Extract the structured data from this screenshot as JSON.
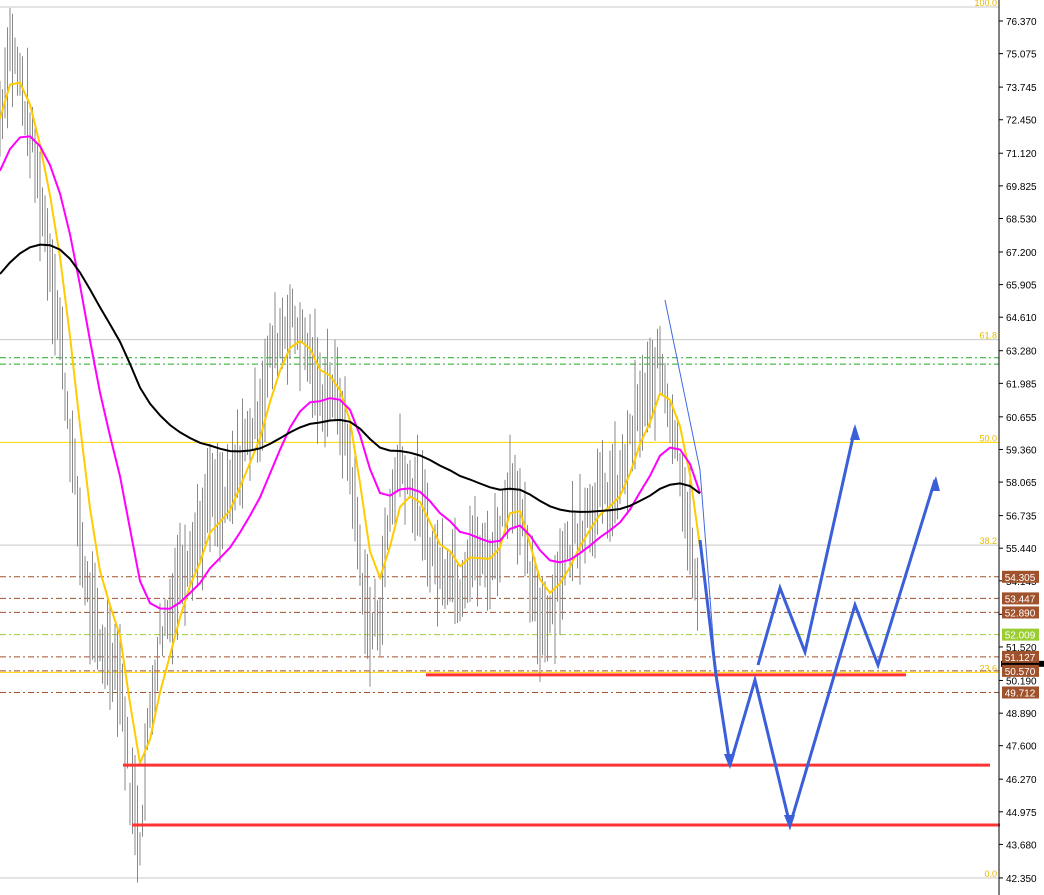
{
  "chart_data": {
    "type": "line",
    "title": "",
    "symbol_ohlc_bars": "price",
    "ylim": [
      42.35,
      76.93
    ],
    "y_ticks": [
      "76.370",
      "75.075",
      "73.745",
      "72.450",
      "71.120",
      "69.825",
      "68.530",
      "67.200",
      "65.905",
      "64.610",
      "63.280",
      "61.985",
      "60.655",
      "59.360",
      "58.065",
      "56.735",
      "55.440",
      "54.145",
      "52.815",
      "51.520",
      "50.190",
      "48.890",
      "47.600",
      "46.270",
      "44.975",
      "43.680",
      "42.350"
    ],
    "closes": [
      72.5,
      75.5,
      74,
      72,
      69.5,
      67,
      64,
      60,
      56,
      53,
      51.5,
      51.5,
      50.5,
      46,
      44,
      49,
      52,
      53,
      54.5,
      55.5,
      56,
      57.5,
      57,
      57.5,
      59,
      60,
      61,
      63,
      64,
      64.5,
      64,
      63,
      61.5,
      62,
      61,
      59,
      55,
      52,
      53,
      57,
      59,
      58,
      57,
      55.5,
      54.5,
      55,
      54,
      55.5,
      55,
      55,
      56,
      58.5,
      57,
      54,
      52.5,
      53,
      54.5,
      55.5,
      56.5,
      57,
      57.5,
      57.5,
      58,
      59.5,
      61,
      61.5,
      63,
      61,
      59,
      56,
      52
    ],
    "moving_averages": [
      {
        "name": "fast",
        "color": "#ffcc00",
        "seed": 72.5,
        "alpha": 0.45
      },
      {
        "name": "medium",
        "color": "#ff00ff",
        "seed": 70,
        "alpha": 0.17
      },
      {
        "name": "slow",
        "color": "#000000",
        "seed": 66,
        "alpha": 0.05
      }
    ],
    "fibonacci": [
      {
        "label": "100.0",
        "price": 76.93
      },
      {
        "label": "61.8",
        "price": 63.72
      },
      {
        "label": "50.0",
        "price": 59.64
      },
      {
        "label": "38.2",
        "price": 55.56
      },
      {
        "label": "23.6",
        "price": 50.51
      },
      {
        "label": "0.0",
        "price": 42.35
      }
    ],
    "price_tags": [
      {
        "label": "54.305",
        "price": 54.305,
        "color": "#a0522d"
      },
      {
        "label": "53.447",
        "price": 53.447,
        "color": "#a0522d"
      },
      {
        "label": "52.890",
        "price": 52.89,
        "color": "#a0522d"
      },
      {
        "label": "52.009",
        "price": 52.009,
        "color": "#9acd32"
      },
      {
        "label": "51.127",
        "price": 51.127,
        "color": "#a0522d"
      },
      {
        "label": "50.570",
        "price": 50.57,
        "color": "#a0522d"
      },
      {
        "label": "49.712",
        "price": 49.712,
        "color": "#a0522d"
      }
    ],
    "support_lines": [
      50.41,
      46.83,
      44.45
    ],
    "green_levels": [
      63.0,
      62.75
    ]
  }
}
